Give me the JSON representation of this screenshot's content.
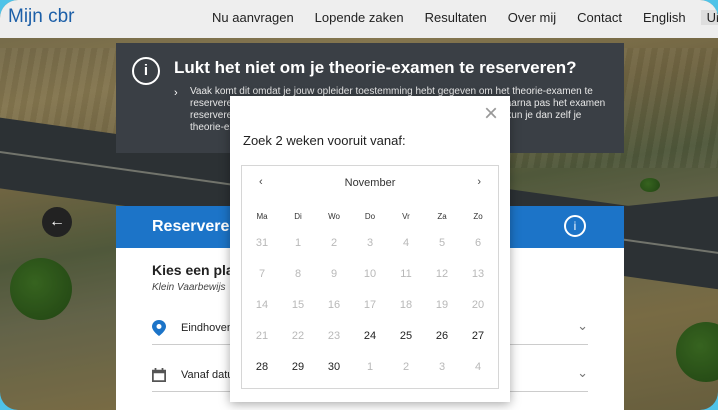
{
  "brand": "Mijn cbr",
  "nav": [
    "Nu aanvragen",
    "Lopende zaken",
    "Resultaten",
    "Over mij",
    "Contact",
    "English",
    "Uitlogg"
  ],
  "banner": {
    "title": "Lukt het niet om je theorie-examen te reserveren?",
    "text": "Vaak komt dit omdat je jouw opleider toestemming hebt gegeven om het theorie-examen te reserveren. Wil je zelf reserveren? Trek dan de machtiging in. Je kunt daarna pas het examen reserveren. Als je de opleider geen toestemming geeft, kunnen ze later kun je dan zelf je theorie-examen reserveren."
  },
  "card": {
    "title": "Reserveren",
    "sub": "Kies een pla",
    "sub2": "Klein Vaarbewijs",
    "location": "Eindhoven",
    "date_label": "Vanaf datum"
  },
  "modal": {
    "title": "Zoek 2 weken vooruit vanaf:",
    "close": "×"
  },
  "calendar": {
    "month": "November",
    "prev": "‹",
    "next": "›",
    "dow": [
      "Ma",
      "Di",
      "Wo",
      "Do",
      "Vr",
      "Za",
      "Zo"
    ],
    "weeks": [
      [
        {
          "d": "31",
          "on": false
        },
        {
          "d": "1",
          "on": false
        },
        {
          "d": "2",
          "on": false
        },
        {
          "d": "3",
          "on": false
        },
        {
          "d": "4",
          "on": false
        },
        {
          "d": "5",
          "on": false
        },
        {
          "d": "6",
          "on": false
        }
      ],
      [
        {
          "d": "7",
          "on": false
        },
        {
          "d": "8",
          "on": false
        },
        {
          "d": "9",
          "on": false
        },
        {
          "d": "10",
          "on": false
        },
        {
          "d": "11",
          "on": false
        },
        {
          "d": "12",
          "on": false
        },
        {
          "d": "13",
          "on": false
        }
      ],
      [
        {
          "d": "14",
          "on": false
        },
        {
          "d": "15",
          "on": false
        },
        {
          "d": "16",
          "on": false
        },
        {
          "d": "17",
          "on": false
        },
        {
          "d": "18",
          "on": false
        },
        {
          "d": "19",
          "on": false
        },
        {
          "d": "20",
          "on": false
        }
      ],
      [
        {
          "d": "21",
          "on": false
        },
        {
          "d": "22",
          "on": false
        },
        {
          "d": "23",
          "on": false
        },
        {
          "d": "24",
          "on": true
        },
        {
          "d": "25",
          "on": true
        },
        {
          "d": "26",
          "on": true
        },
        {
          "d": "27",
          "on": true
        }
      ],
      [
        {
          "d": "28",
          "on": true
        },
        {
          "d": "29",
          "on": true
        },
        {
          "d": "30",
          "on": true
        },
        {
          "d": "1",
          "on": false
        },
        {
          "d": "2",
          "on": false
        },
        {
          "d": "3",
          "on": false
        },
        {
          "d": "4",
          "on": false
        }
      ]
    ]
  },
  "icons": {
    "info": "i",
    "back": "←",
    "chevron": "⌄"
  }
}
